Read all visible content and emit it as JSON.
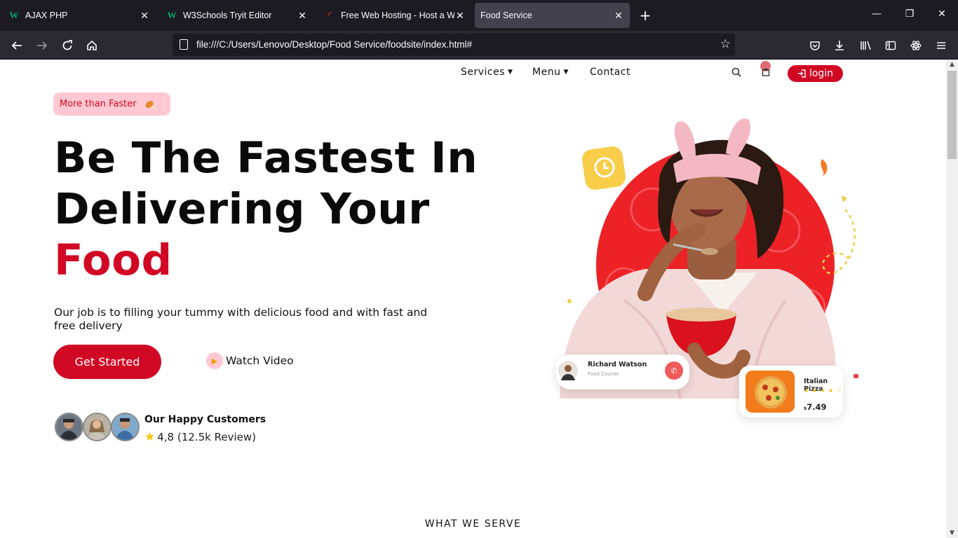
{
  "browser": {
    "tabs": [
      {
        "title": "AJAX PHP",
        "favicon": "w3schools-icon"
      },
      {
        "title": "W3Schools Tryit Editor",
        "favicon": "w3schools-icon"
      },
      {
        "title": "Free Web Hosting - Host a Web",
        "favicon": "hosting-icon"
      },
      {
        "title": "Food Service",
        "favicon": "none"
      }
    ],
    "active_tab": 3,
    "url": "file:///C:/Users/Lenovo/Desktop/Food Service/foodsite/index.html#"
  },
  "site": {
    "nav": {
      "services": "Services",
      "menu": "Menu",
      "contact": "Contact",
      "login": "login"
    },
    "pill": "More than Faster",
    "headline": {
      "line1": "Be The Fastest In",
      "line2": "Delivering Your",
      "line3": "Food"
    },
    "lead": "Our job is to filling your tummy with delicious food and with fast and free delivery",
    "cta": "Get Started",
    "watch": "Watch Video",
    "customers": {
      "title": "Our Happy Customers",
      "rating": "4,8 (12.5k Review)"
    },
    "courier": {
      "name": "Richard Watson",
      "role": "Food Courier"
    },
    "dish": {
      "name": "Italian Pizza",
      "stars": "★ ★ ★ ★ ☆",
      "currency": "$",
      "price": "7.49"
    },
    "section_heading": "WHAT WE SERVE"
  },
  "colors": {
    "brand_red": "#d10824",
    "pill_bg": "#ffc8d2",
    "chrome_dark": "#1c1b22",
    "chrome_toolbar": "#2b2a33"
  }
}
